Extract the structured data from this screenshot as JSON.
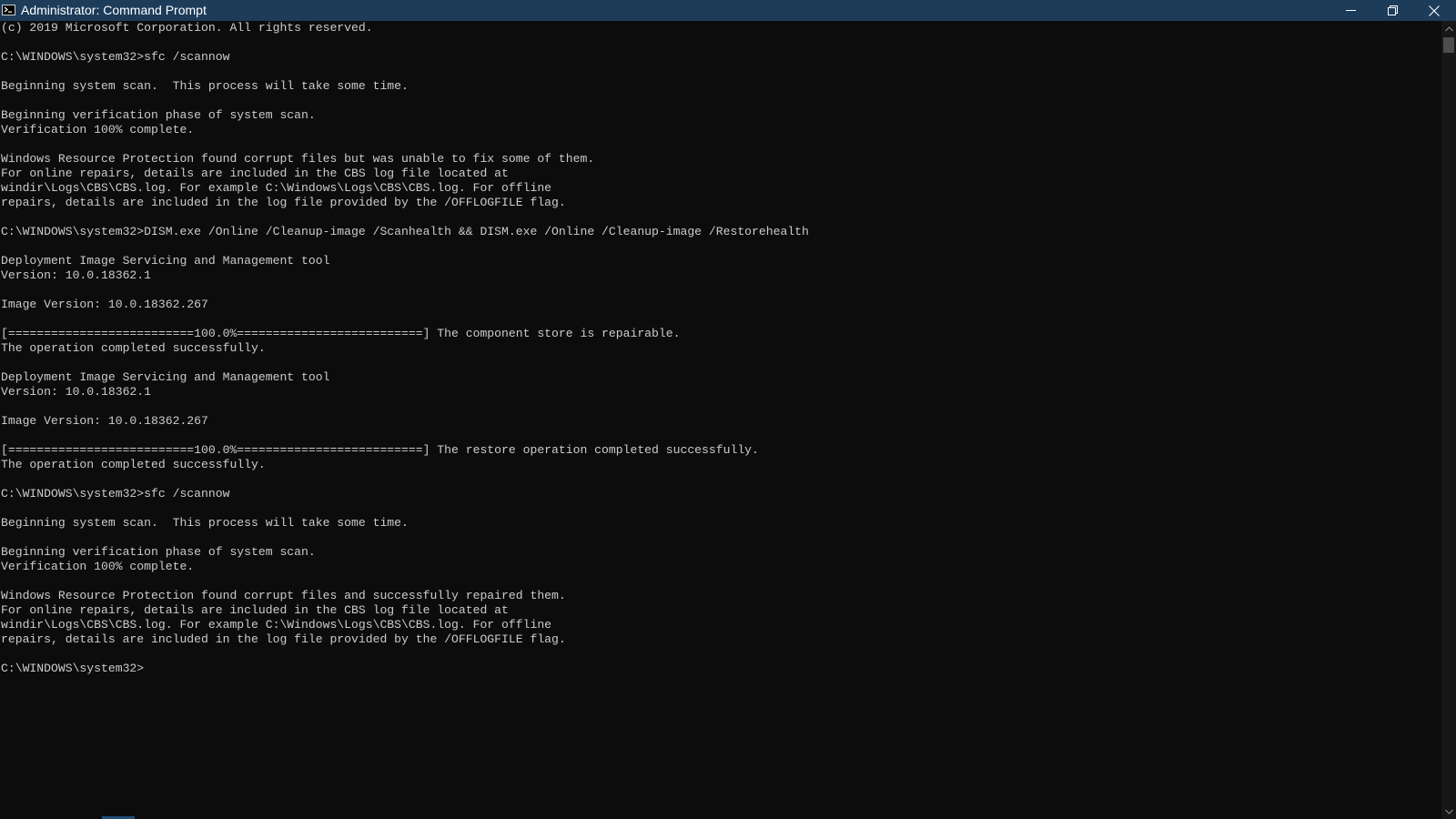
{
  "window": {
    "title": "Administrator: Command Prompt"
  },
  "titlebar_icons": {
    "app": "command-prompt-icon",
    "minimize": "minimize-icon",
    "maximize": "restore-icon",
    "close": "close-icon"
  },
  "colors": {
    "titlebar": "#1c3c5a",
    "console_background": "#0c0c0c",
    "console_text": "#cccccc"
  },
  "console": {
    "lines": [
      "(c) 2019 Microsoft Corporation. All rights reserved.",
      "",
      "C:\\WINDOWS\\system32>sfc /scannow",
      "",
      "Beginning system scan.  This process will take some time.",
      "",
      "Beginning verification phase of system scan.",
      "Verification 100% complete.",
      "",
      "Windows Resource Protection found corrupt files but was unable to fix some of them.",
      "For online repairs, details are included in the CBS log file located at",
      "windir\\Logs\\CBS\\CBS.log. For example C:\\Windows\\Logs\\CBS\\CBS.log. For offline",
      "repairs, details are included in the log file provided by the /OFFLOGFILE flag.",
      "",
      "C:\\WINDOWS\\system32>DISM.exe /Online /Cleanup-image /Scanhealth && DISM.exe /Online /Cleanup-image /Restorehealth",
      "",
      "Deployment Image Servicing and Management tool",
      "Version: 10.0.18362.1",
      "",
      "Image Version: 10.0.18362.267",
      "",
      "[==========================100.0%==========================] The component store is repairable.",
      "The operation completed successfully.",
      "",
      "Deployment Image Servicing and Management tool",
      "Version: 10.0.18362.1",
      "",
      "Image Version: 10.0.18362.267",
      "",
      "[==========================100.0%==========================] The restore operation completed successfully.",
      "The operation completed successfully.",
      "",
      "C:\\WINDOWS\\system32>sfc /scannow",
      "",
      "Beginning system scan.  This process will take some time.",
      "",
      "Beginning verification phase of system scan.",
      "Verification 100% complete.",
      "",
      "Windows Resource Protection found corrupt files and successfully repaired them.",
      "For online repairs, details are included in the CBS log file located at",
      "windir\\Logs\\CBS\\CBS.log. For example C:\\Windows\\Logs\\CBS\\CBS.log. For offline",
      "repairs, details are included in the log file provided by the /OFFLOGFILE flag.",
      "",
      "C:\\WINDOWS\\system32>"
    ]
  },
  "scrollbar": {
    "up_icon": "chevron-up-icon",
    "down_icon": "chevron-down-icon"
  }
}
